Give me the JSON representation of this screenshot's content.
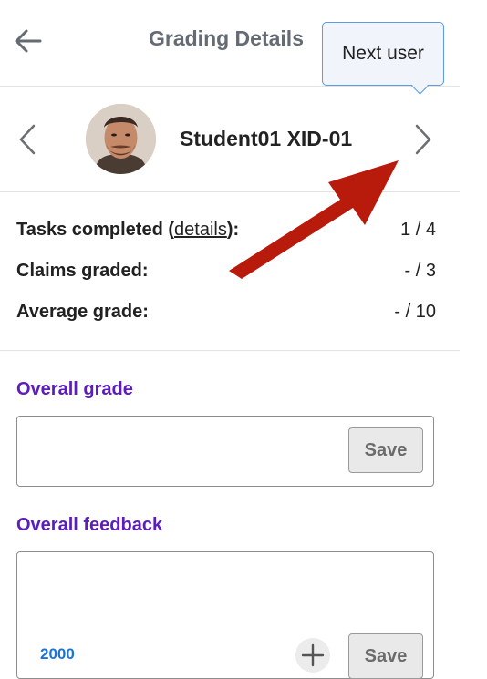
{
  "header": {
    "title": "Grading Details"
  },
  "tooltip": {
    "text": "Next user"
  },
  "student": {
    "name": "Student01 XID-01"
  },
  "stats": {
    "tasks_label": "Tasks completed (",
    "tasks_link": "details",
    "tasks_suffix": "):",
    "tasks_value": "1 / 4",
    "claims_label": "Claims graded:",
    "claims_value": "- / 3",
    "average_label": "Average grade:",
    "average_value": "- / 10"
  },
  "grade": {
    "title": "Overall grade",
    "save_label": "Save"
  },
  "feedback": {
    "title": "Overall feedback",
    "save_label": "Save",
    "word_count": "2000"
  },
  "colors": {
    "accent_purple": "#5b1dbd",
    "tooltip_border": "#5a9be2",
    "arrow_red": "#b81a0c",
    "count_blue": "#1a73d9"
  },
  "icons": [
    "back-arrow-icon",
    "chevron-left-icon",
    "chevron-right-icon",
    "plus-icon",
    "annotation-arrow"
  ]
}
